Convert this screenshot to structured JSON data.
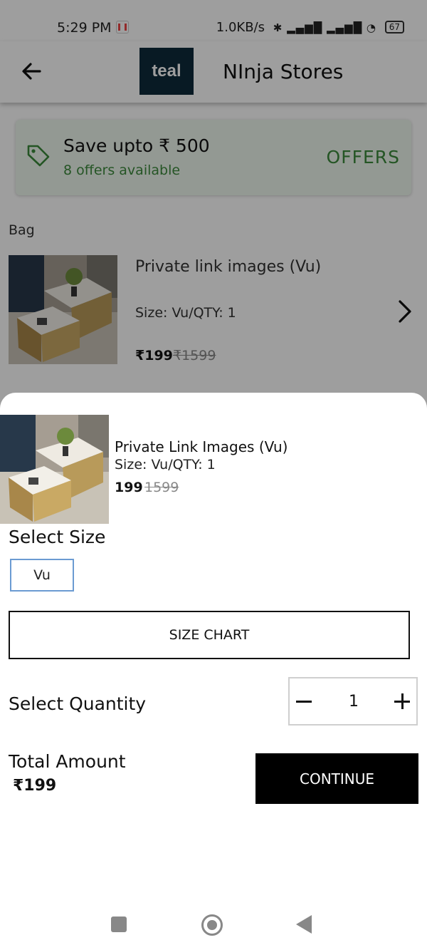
{
  "status_bar": {
    "time": "5:29 PM",
    "network_speed": "1.0KB/s",
    "battery": "67",
    "icons": [
      "gmail-icon",
      "bluetooth-icon",
      "signal-icon",
      "vowifi-icon",
      "volte-icon",
      "signal-icon",
      "wifi-icon",
      "battery-icon"
    ]
  },
  "app_bar": {
    "logo_text": "teal",
    "store_name": "NInja Stores",
    "back_icon": "arrow-left-icon"
  },
  "offers": {
    "title": "Save upto ₹ 500",
    "subtitle": "8 offers available",
    "link": "OFFERS",
    "icon": "tag-icon",
    "accent": "#3a8a3a"
  },
  "bag": {
    "label": "Bag",
    "item": {
      "name": "Private link images (Vu)",
      "size_qty": "Size: Vu/QTY: 1",
      "price": "₹199",
      "mrp": "₹1599",
      "chevron": "chevron-right-icon"
    }
  },
  "sheet": {
    "product": {
      "name": "Private Link Images (Vu)",
      "size_qty": "Size: Vu/QTY: 1",
      "price": "199",
      "mrp": "1599"
    },
    "select_size_label": "Select Size",
    "size_option": "Vu",
    "size_chart_label": "SIZE CHART",
    "select_quantity_label": "Select Quantity",
    "quantity": "1",
    "total_label": "Total Amount",
    "total_value": "₹199",
    "continue_label": "CONTINUE"
  },
  "nav_bar": {
    "icons": [
      "recents-icon",
      "home-icon",
      "back-icon"
    ]
  }
}
